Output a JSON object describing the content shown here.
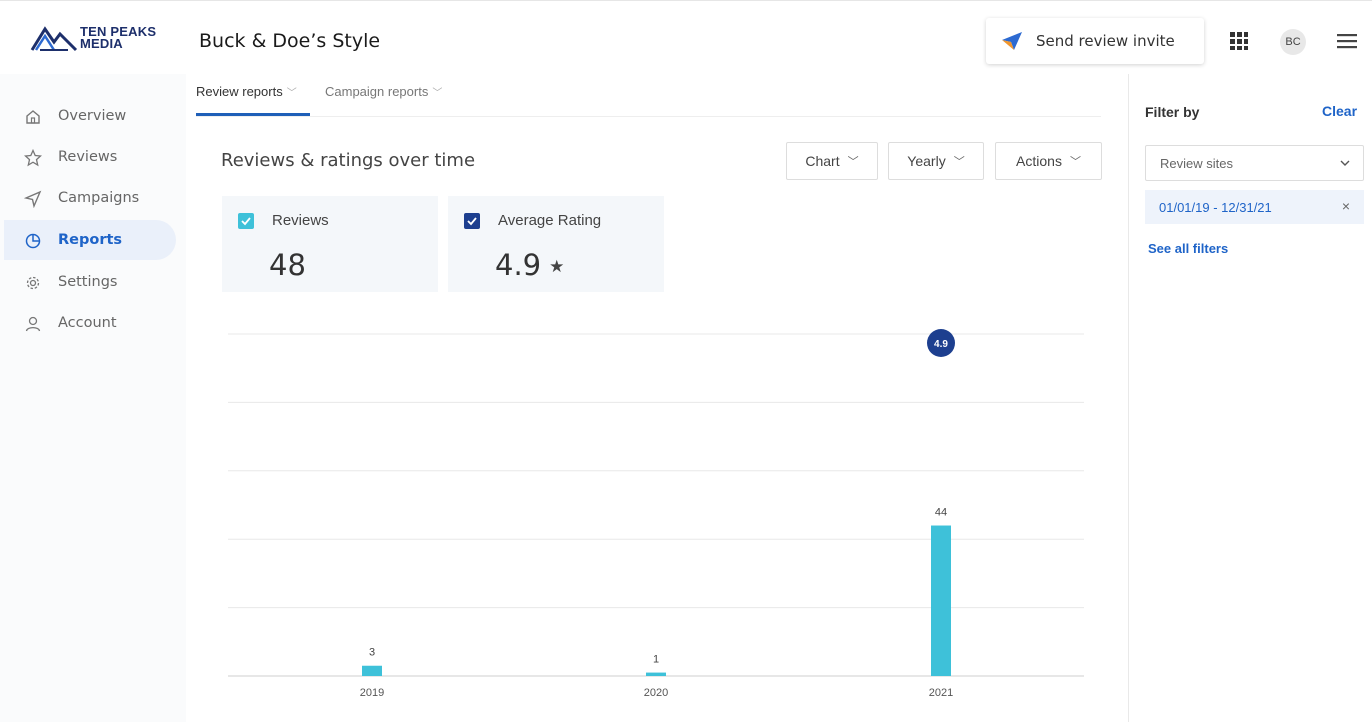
{
  "header": {
    "logo_text_line1": "TEN PEAKS",
    "logo_text_line2": "MEDIA",
    "business_name": "Buck & Doe’s Style",
    "send_invite_label": "Send review invite",
    "avatar_initials": "BC",
    "icons": [
      "paper-plane-icon",
      "apps-grid-icon",
      "hamburger-menu-icon"
    ]
  },
  "sidebar": {
    "items": [
      {
        "label": "Overview",
        "icon": "home-icon",
        "active": false
      },
      {
        "label": "Reviews",
        "icon": "star-icon",
        "active": false
      },
      {
        "label": "Campaigns",
        "icon": "send-icon",
        "active": false
      },
      {
        "label": "Reports",
        "icon": "pie-chart-icon",
        "active": true
      },
      {
        "label": "Settings",
        "icon": "gear-icon",
        "active": false
      },
      {
        "label": "Account",
        "icon": "user-icon",
        "active": false
      }
    ]
  },
  "main": {
    "tabs": [
      {
        "label": "Review reports",
        "active": true
      },
      {
        "label": "Campaign reports",
        "active": false
      }
    ],
    "section_title": "Reviews & ratings over time",
    "dropdowns": {
      "chart": "Chart",
      "period": "Yearly",
      "actions": "Actions"
    },
    "metrics": [
      {
        "label": "Reviews",
        "value": "48",
        "color": "#3ec1d9"
      },
      {
        "label": "Average Rating",
        "value": "4.9",
        "suffix": "★",
        "color": "#1d3f8f"
      }
    ]
  },
  "chart_data": {
    "type": "bar",
    "categories": [
      "2019",
      "2020",
      "2021"
    ],
    "series": [
      {
        "values": [
          3,
          1,
          44
        ],
        "color": "#3ec1d9"
      },
      {
        "values": [
          null,
          null,
          4.9
        ],
        "color": "#1d3f8f"
      }
    ],
    "data_labels": [
      "3",
      "1",
      "44"
    ],
    "rating_label": "4.9",
    "ylim": [
      0,
      100
    ],
    "grid": true
  },
  "filter": {
    "title": "Filter by",
    "clear_label": "Clear",
    "review_sites_placeholder": "Review sites",
    "date_range": "01/01/19 - 12/31/21",
    "remove_icon": "×",
    "see_all_label": "See all filters"
  },
  "colors": {
    "accent": "#1f64c8",
    "bar": "#3ec1d9",
    "rating": "#1d3f8f"
  }
}
